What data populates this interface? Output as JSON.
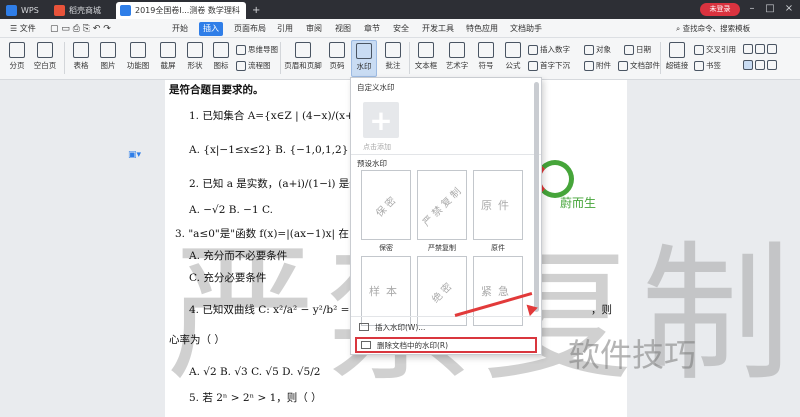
{
  "titlebar": {
    "tabs": [
      {
        "label": "WPS",
        "icon": "wps-logo-icon"
      },
      {
        "label": "稻壳商城",
        "icon": "docer-shop-icon"
      },
      {
        "label": "2019全国卷Ⅰ...测卷 数学理科",
        "icon": "document-icon"
      }
    ],
    "login_label": "未登录"
  },
  "menubar": {
    "file_label": "文件",
    "items": [
      "开始",
      "插入",
      "页面布局",
      "引用",
      "审阅",
      "视图",
      "章节",
      "安全",
      "开发工具",
      "特色应用",
      "文档助手"
    ],
    "active": "插入",
    "search_hint": "查找命令、搜索模板"
  },
  "ribbon": {
    "buttons": [
      "分页",
      "空白页",
      "表格",
      "图片",
      "功能图",
      "截屏",
      "形状",
      "图标",
      "思维导图",
      "流程图",
      "页眉和页脚",
      "页码",
      "水印",
      "批注",
      "文本框",
      "艺术字",
      "符号",
      "公式",
      "插入数字",
      "对象",
      "日期",
      "首字下沉",
      "附件",
      "文档部件",
      "超链接",
      "交叉引用",
      "书签"
    ]
  },
  "document": {
    "heading": "是符合题目要求的。",
    "lines": [
      "1. 已知集合 A={x∈Z | (4−x)/(x+2) ≥ 0}， B",
      "A. {x|−1≤x≤2}    B. {−1,0,1,2}",
      "2. 已知 a 是实数，(a+i)/(1−i) 是纯虚数",
      "A. −√2      B. −1            C.",
      "3. \"a≤0\"是\"函数 f(x)=|(ax−1)x| 在",
      "A. 充分而不必要条件",
      "C. 充分必要条件",
      "4. 已知双曲线 C: x²/a² − y²/b² =1(a>0,b>",
      "心率为（    ）",
      "A. √2       B. √3       C. √5       D. √5/2",
      "5. 若 2ⁿ > 2ⁿ > 1，则（    ）"
    ],
    "trailing_text": "，则",
    "watermark_big": "严禁复制",
    "watermark_small": "软件技巧",
    "logo_text": "蔚而生"
  },
  "dropdown": {
    "custom_section": "自定义水印",
    "add_label": "点击添加",
    "preset_section": "预设水印",
    "presets": [
      {
        "text": "保密",
        "label": "保密"
      },
      {
        "text": "严禁复制",
        "label": "严禁复制"
      },
      {
        "text": "原件",
        "label": "原件"
      },
      {
        "text": "样本",
        "label": ""
      },
      {
        "text": "绝密",
        "label": ""
      },
      {
        "text": "紧急",
        "label": ""
      }
    ],
    "insert_item": "插入水印(W)...",
    "delete_item": "删除文档中的水印(R)"
  },
  "colors": {
    "accent": "#2f7ee8",
    "highlight": "#d9363e"
  }
}
